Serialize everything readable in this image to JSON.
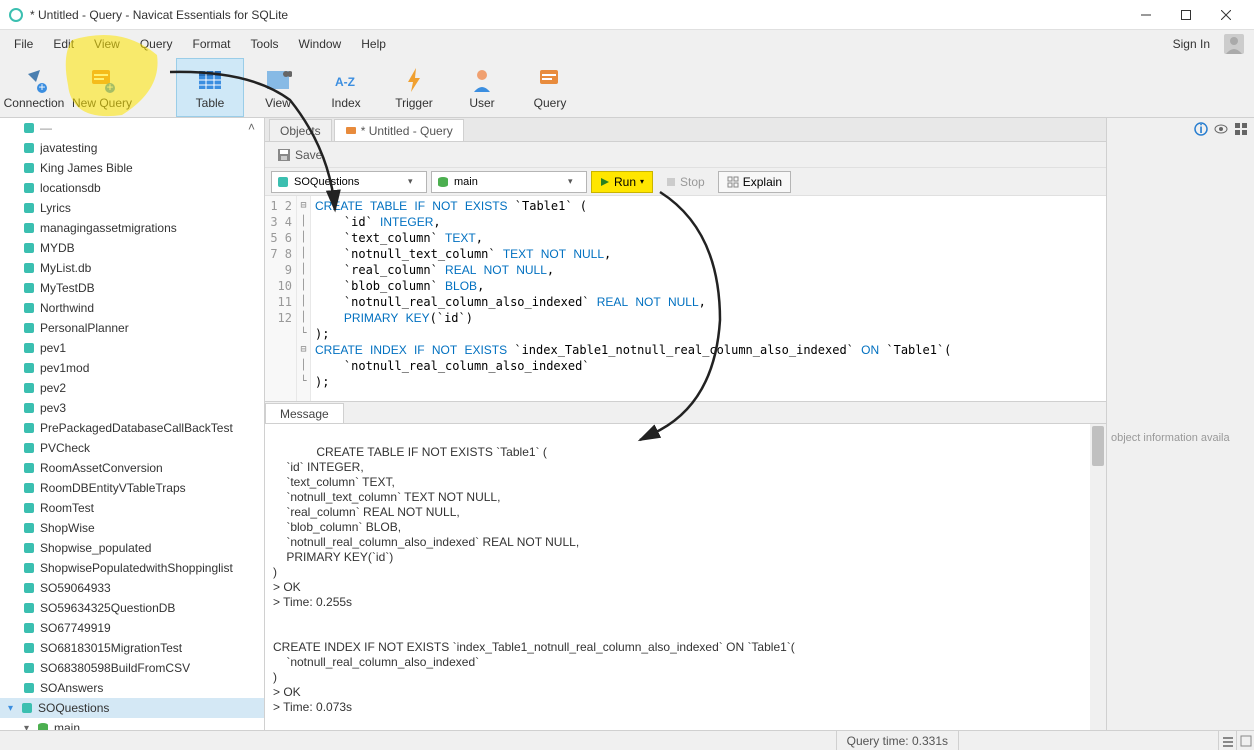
{
  "window": {
    "title": "* Untitled - Query - Navicat Essentials for SQLite"
  },
  "menu": {
    "items": [
      "File",
      "Edit",
      "View",
      "Query",
      "Format",
      "Tools",
      "Window",
      "Help"
    ],
    "signin": "Sign In"
  },
  "toolbar": {
    "connection": "Connection",
    "newquery": "New Query",
    "table": "Table",
    "view": "View",
    "index": "Index",
    "trigger": "Trigger",
    "user": "User",
    "query": "Query"
  },
  "sidebar": {
    "items": [
      "javatesting",
      "King James Bible",
      "locationsdb",
      "Lyrics",
      "managingassetmigrations",
      "MYDB",
      "MyList.db",
      "MyTestDB",
      "Northwind",
      "PersonalPlanner",
      "pev1",
      "pev1mod",
      "pev2",
      "pev3",
      "PrePackagedDatabaseCallBackTest",
      "PVCheck",
      "RoomAssetConversion",
      "RoomDBEntityVTableTraps",
      "RoomTest",
      "ShopWise",
      "Shopwise_populated",
      "ShopwisePopulatedwithShoppinglist",
      "SO59064933",
      "SO59634325QuestionDB",
      "SO67749919",
      "SO68183015MigrationTest",
      "SO68380598BuildFromCSV",
      "SOAnswers"
    ],
    "selected": "SOQuestions",
    "child": "main"
  },
  "tabs": {
    "objects": "Objects",
    "active": "* Untitled - Query"
  },
  "toolbar2": {
    "save": "Save"
  },
  "querybar": {
    "conn": "SOQuestions",
    "db": "main",
    "run": "Run",
    "stop": "Stop",
    "explain": "Explain"
  },
  "editor": {
    "lines": [
      "CREATE TABLE IF NOT EXISTS `Table1` (",
      "    `id` INTEGER,",
      "    `text_column` TEXT,",
      "    `notnull_text_column` TEXT NOT NULL,",
      "    `real_column` REAL NOT NULL,",
      "    `blob_column` BLOB,",
      "    `notnull_real_column_also_indexed` REAL NOT NULL,",
      "    PRIMARY KEY(`id`)",
      ");",
      "CREATE INDEX IF NOT EXISTS `index_Table1_notnull_real_column_also_indexed` ON `Table1`(",
      "    `notnull_real_column_also_indexed`",
      ");"
    ]
  },
  "msgtab": "Message",
  "message": "CREATE TABLE IF NOT EXISTS `Table1` (\n    `id` INTEGER,\n    `text_column` TEXT,\n    `notnull_text_column` TEXT NOT NULL,\n    `real_column` REAL NOT NULL,\n    `blob_column` BLOB,\n    `notnull_real_column_also_indexed` REAL NOT NULL,\n    PRIMARY KEY(`id`)\n)\n> OK\n> Time: 0.255s\n\n\nCREATE INDEX IF NOT EXISTS `index_Table1_notnull_real_column_also_indexed` ON `Table1`(\n    `notnull_real_column_also_indexed`\n)\n> OK\n> Time: 0.073s",
  "infopanel": {
    "text": "object information availa"
  },
  "status": {
    "querytime": "Query time: 0.331s"
  }
}
